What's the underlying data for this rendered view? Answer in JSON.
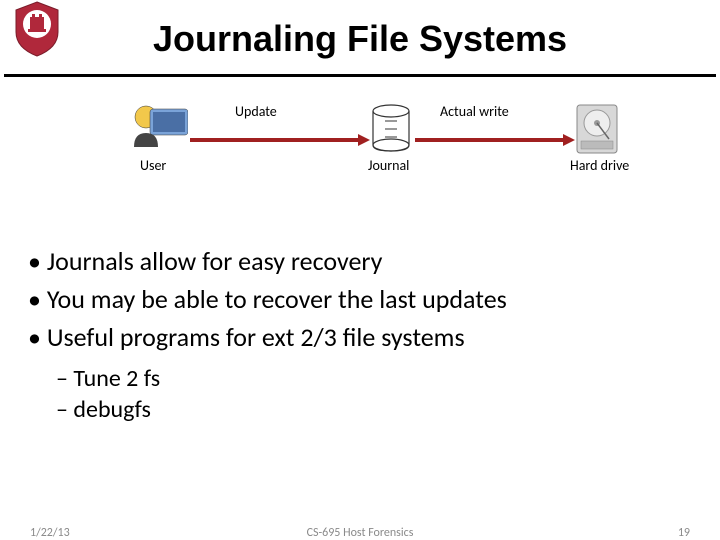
{
  "title": "Journaling File Systems",
  "diagram": {
    "label_update": "Update",
    "label_actual_write": "Actual write",
    "label_user": "User",
    "label_journal": "Journal",
    "label_hard_drive": "Hard drive"
  },
  "bullets": {
    "b1": "Journals allow for easy recovery",
    "b2": "You may be able to recover the last updates",
    "b3": "Useful programs for ext 2/3 file systems",
    "sub1": "Tune 2 fs",
    "sub2": "debugfs"
  },
  "footer": {
    "date": "1/22/13",
    "course": "CS-695 Host Forensics",
    "page": "19"
  }
}
